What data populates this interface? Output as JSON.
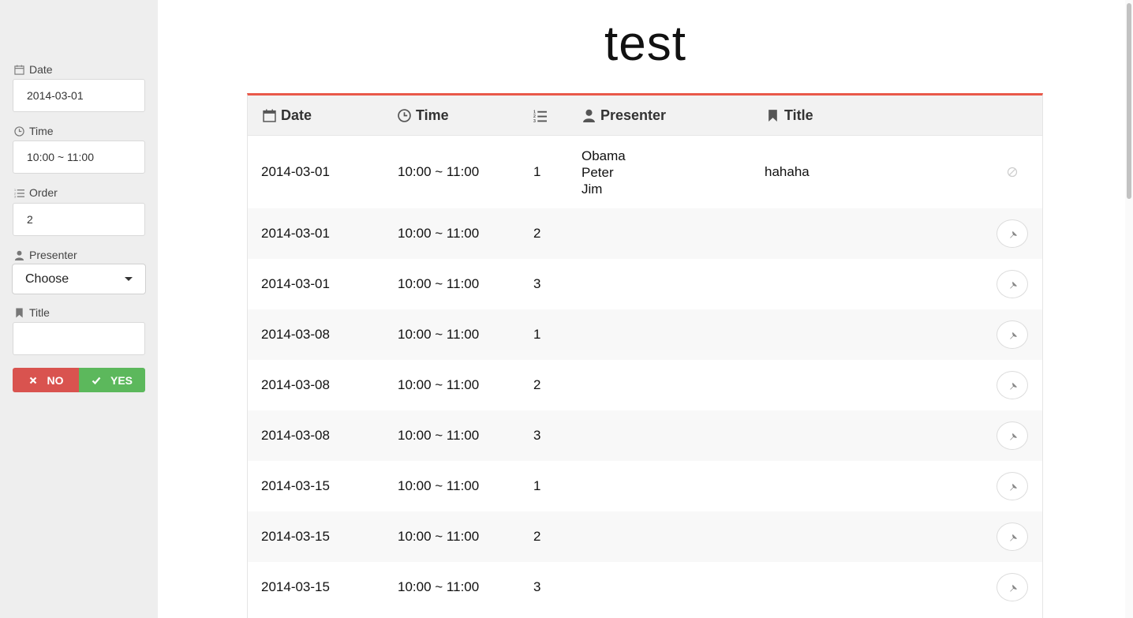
{
  "sidebar": {
    "date": {
      "label": "Date",
      "icon": "calendar-icon",
      "value": "2014-03-01"
    },
    "time": {
      "label": "Time",
      "icon": "clock-icon",
      "value": "10:00 ~ 11:00"
    },
    "order": {
      "label": "Order",
      "icon": "list-ordered-icon",
      "value": "2"
    },
    "presenter": {
      "label": "Presenter",
      "icon": "user-icon",
      "selected": "Choose"
    },
    "title": {
      "label": "Title",
      "icon": "bookmark-icon",
      "value": ""
    },
    "no_label": "NO",
    "yes_label": "YES"
  },
  "page_title": "test",
  "table": {
    "headers": {
      "date": "Date",
      "time": "Time",
      "presenter": "Presenter",
      "title": "Title"
    },
    "rows": [
      {
        "date": "2014-03-01",
        "time": "10:00 ~ 11:00",
        "order": "1",
        "presenters": [
          "Obama",
          "Peter",
          "Jim"
        ],
        "title": "hahaha",
        "action": "ban-icon"
      },
      {
        "date": "2014-03-01",
        "time": "10:00 ~ 11:00",
        "order": "2",
        "presenters": [],
        "title": "",
        "action": "pin-icon"
      },
      {
        "date": "2014-03-01",
        "time": "10:00 ~ 11:00",
        "order": "3",
        "presenters": [],
        "title": "",
        "action": "pin-icon"
      },
      {
        "date": "2014-03-08",
        "time": "10:00 ~ 11:00",
        "order": "1",
        "presenters": [],
        "title": "",
        "action": "pin-icon"
      },
      {
        "date": "2014-03-08",
        "time": "10:00 ~ 11:00",
        "order": "2",
        "presenters": [],
        "title": "",
        "action": "pin-icon"
      },
      {
        "date": "2014-03-08",
        "time": "10:00 ~ 11:00",
        "order": "3",
        "presenters": [],
        "title": "",
        "action": "pin-icon"
      },
      {
        "date": "2014-03-15",
        "time": "10:00 ~ 11:00",
        "order": "1",
        "presenters": [],
        "title": "",
        "action": "pin-icon"
      },
      {
        "date": "2014-03-15",
        "time": "10:00 ~ 11:00",
        "order": "2",
        "presenters": [],
        "title": "",
        "action": "pin-icon"
      },
      {
        "date": "2014-03-15",
        "time": "10:00 ~ 11:00",
        "order": "3",
        "presenters": [],
        "title": "",
        "action": "pin-icon"
      }
    ]
  },
  "colors": {
    "accent": "#e9594a",
    "no": "#d9534f",
    "yes": "#5cb85c",
    "sidebar_bg": "#eeeeee"
  }
}
